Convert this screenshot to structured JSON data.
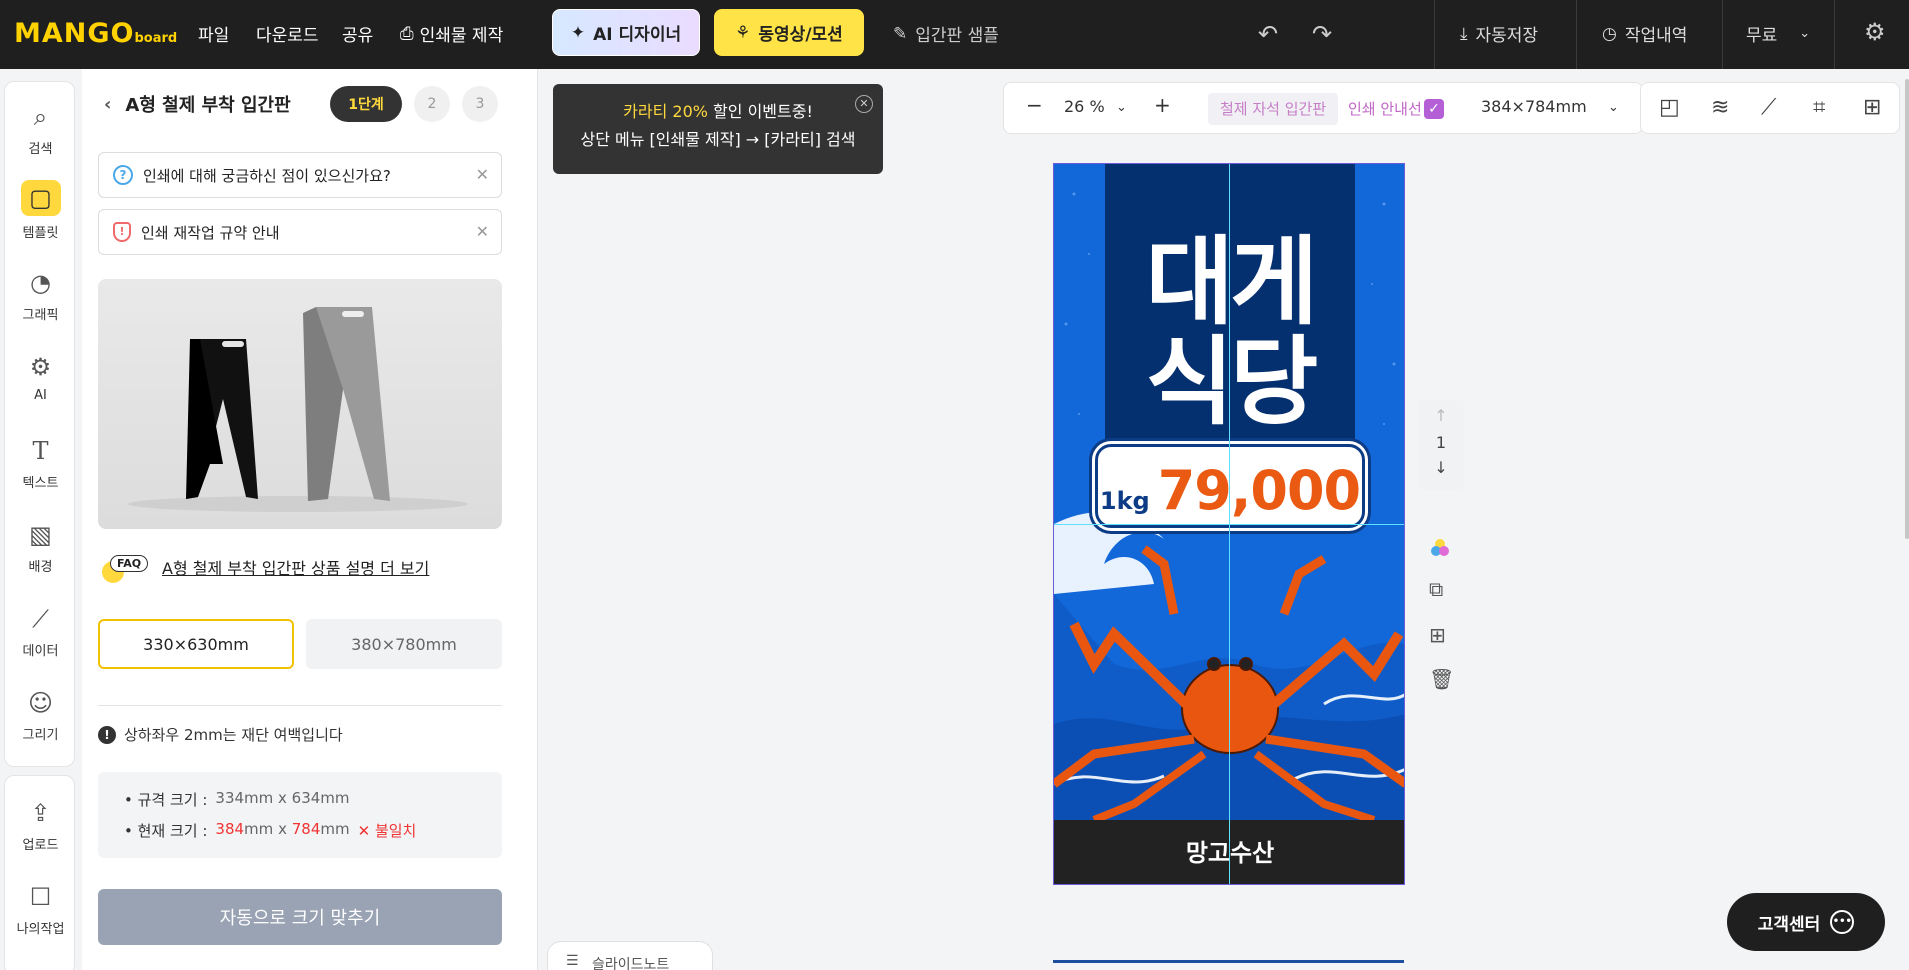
{
  "app": {
    "logo_main": "MANGO",
    "logo_sub": "board"
  },
  "topbar": {
    "menu": [
      "파일",
      "다운로드",
      "공유",
      "인쇄물 제작"
    ],
    "ai_designer": "AI 디자이너",
    "video_motion": "동영상/모션",
    "sample": "입간판 샘플",
    "autosave": "자동저장",
    "history": "작업내역",
    "plan": "무료"
  },
  "rail": {
    "items": [
      {
        "label": "검색",
        "icon": "search-icon"
      },
      {
        "label": "템플릿",
        "icon": "template-icon"
      },
      {
        "label": "그래픽",
        "icon": "graphic-icon"
      },
      {
        "label": "AI",
        "icon": "ai-chip-icon"
      },
      {
        "label": "텍스트",
        "icon": "text-icon"
      },
      {
        "label": "배경",
        "icon": "background-icon"
      },
      {
        "label": "데이터",
        "icon": "chart-icon"
      },
      {
        "label": "그리기",
        "icon": "draw-icon"
      }
    ],
    "items2": [
      {
        "label": "업로드",
        "icon": "upload-icon"
      },
      {
        "label": "나의작업",
        "icon": "my-work-icon"
      }
    ]
  },
  "panel": {
    "title": "A형 철제 부착 입간판",
    "steps": [
      "1단계",
      "2",
      "3"
    ],
    "notice1": "인쇄에 대해 궁금하신 점이 있으신가요?",
    "notice2": "인쇄 재작업 규약 안내",
    "faq_badge": "FAQ",
    "faq_link": "A형 철제 부착 입간판 상품 설명 더 보기",
    "size_option_1": "330×630mm",
    "size_option_2": "380×780mm",
    "bleed_note": "상하좌우 2mm는 재단 여백입니다",
    "spec_label": "• 규격 크기 :",
    "spec_value": "334mm x 634mm",
    "current_label": "• 현재 크기 :",
    "current_w": "384",
    "current_h": "784",
    "unit": "mm",
    "x_sep": "x",
    "mismatch": "불일치",
    "auto_fit": "자동으로 크기 맞추기"
  },
  "canvas": {
    "promo_line1_hl": "카라티 20%",
    "promo_line1_rest": " 할인 이벤트중!",
    "promo_line2": "상단 메뉴 [인쇄물 제작] → [카라티] 검색",
    "zoom": "26 %",
    "product_chip": "철제 자석 입간판",
    "print_guide": "인쇄 안내선",
    "page_size": "384×784mm",
    "page_number": "1",
    "slide_notes": "슬라이드노트",
    "support": "고객센터"
  },
  "poster": {
    "title_line1": "대게",
    "title_line2": "식당",
    "price_unit": "1kg",
    "price_value": "79,000",
    "brand": "망고수산"
  },
  "colors": {
    "accent": "#ffd83d",
    "topbar_bg": "#1f1f1f",
    "poster_blue": "#1268d8",
    "poster_navy": "#05306f",
    "price_orange": "#ea5a12",
    "error_red": "#ef3434"
  }
}
